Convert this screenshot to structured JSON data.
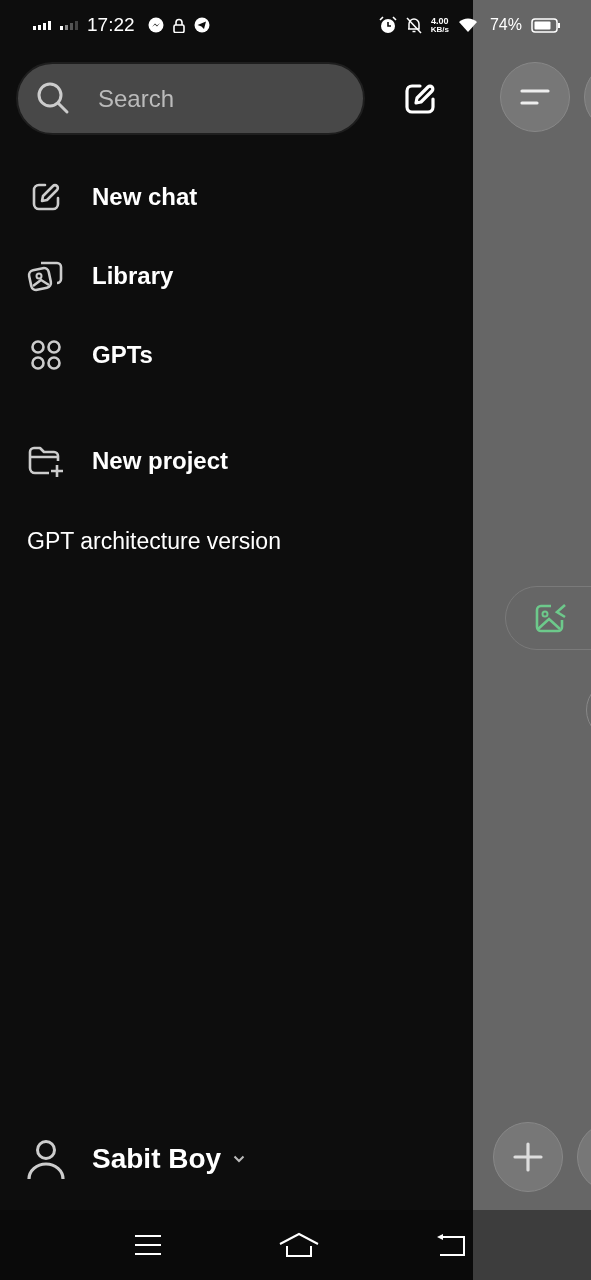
{
  "status_bar": {
    "time": "17:22",
    "speed_value": "4.00",
    "speed_unit": "KB/s",
    "battery": "74%"
  },
  "search": {
    "placeholder": "Search"
  },
  "menu": [
    {
      "label": "New chat",
      "kind": "compose"
    },
    {
      "label": "Library",
      "kind": "library"
    },
    {
      "label": "GPTs",
      "kind": "grid"
    },
    {
      "label": "New project",
      "kind": "folder"
    }
  ],
  "chats": [
    {
      "title": "GPT architecture version"
    }
  ],
  "user": {
    "name": "Sabit Boy"
  }
}
